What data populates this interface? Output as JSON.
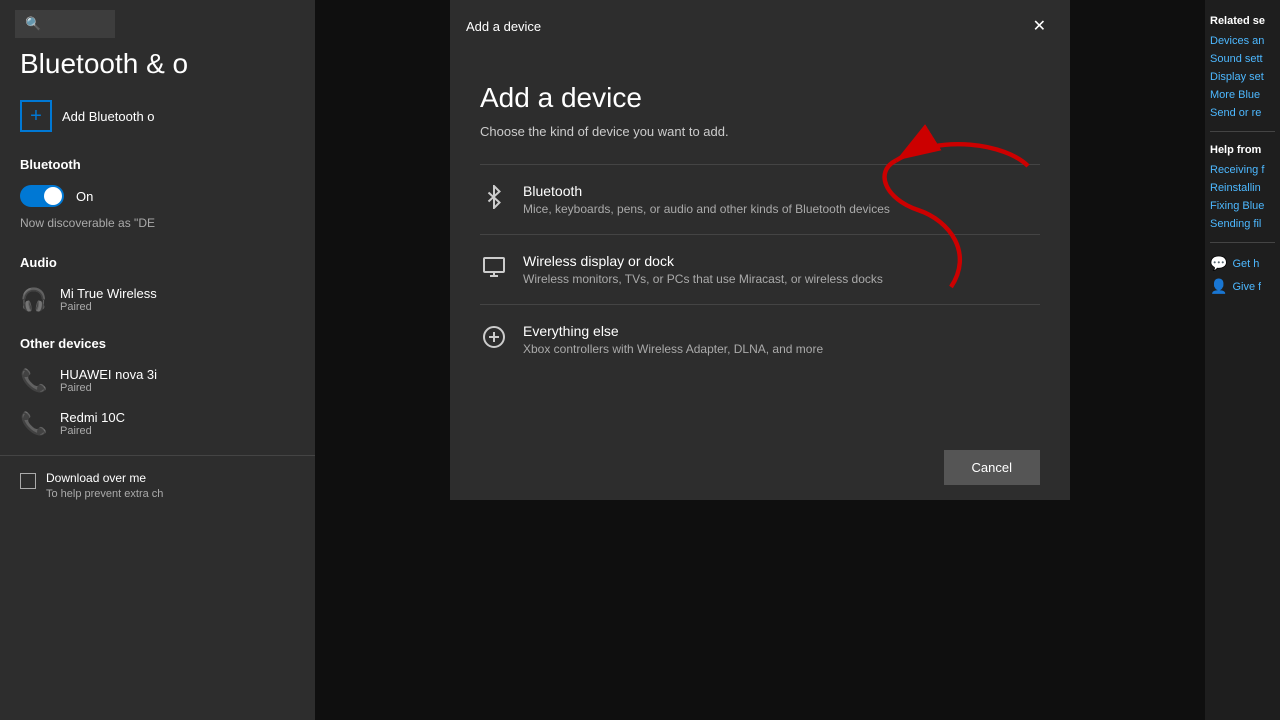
{
  "sidebar": {
    "page_title": "Bluetooth & o",
    "search_placeholder": "🔍",
    "add_bluetooth": {
      "label": "Add Bluetooth o",
      "plus": "+"
    },
    "bluetooth_section": {
      "label": "Bluetooth",
      "toggle_state": "On",
      "discoverable": "Now discoverable as \"DE"
    },
    "audio_section": {
      "label": "Audio",
      "devices": [
        {
          "name": "Mi True Wireless",
          "status": "Paired"
        }
      ]
    },
    "other_devices_section": {
      "label": "Other devices",
      "devices": [
        {
          "name": "HUAWEI nova 3i",
          "status": "Paired"
        },
        {
          "name": "Redmi 10C",
          "status": "Paired"
        }
      ]
    },
    "download_row": {
      "label": "Download over me",
      "sublabel": "To help prevent extra ch"
    }
  },
  "modal": {
    "title_bar": "Add a device",
    "heading": "Add a device",
    "subtitle": "Choose the kind of device you want to add.",
    "options": [
      {
        "id": "bluetooth",
        "title": "Bluetooth",
        "description": "Mice, keyboards, pens, or audio and other kinds of Bluetooth devices"
      },
      {
        "id": "wireless-display",
        "title": "Wireless display or dock",
        "description": "Wireless monitors, TVs, or PCs that use Miracast, or wireless docks"
      },
      {
        "id": "everything-else",
        "title": "Everything else",
        "description": "Xbox controllers with Wireless Adapter, DLNA, and more"
      }
    ],
    "cancel_label": "Cancel"
  },
  "right_sidebar": {
    "related_title": "Related se",
    "related_links": [
      "Devices an",
      "Sound sett",
      "Display set",
      "More Blue",
      "Send or re"
    ],
    "help_title": "Help from",
    "help_links": [
      "Receiving f",
      "Reinstallin",
      "Fixing Blue",
      "Sending fil"
    ],
    "bottom_links": [
      "Get h",
      "Give f"
    ]
  }
}
